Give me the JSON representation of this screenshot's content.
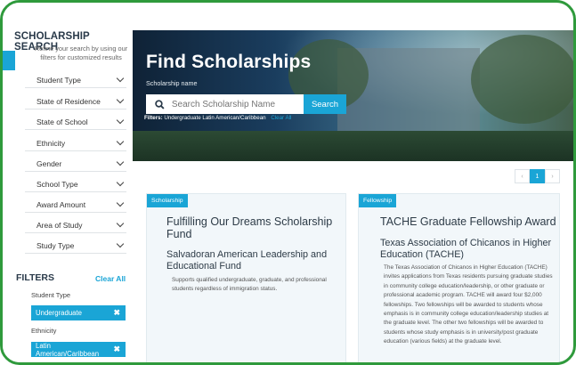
{
  "sidebar": {
    "title": "SCHOLARSHIP SEARCH",
    "subtitle": "Refine your search by using our filters for customized results",
    "selects": [
      {
        "label": "Student Type"
      },
      {
        "label": "State of Residence"
      },
      {
        "label": "State of School"
      },
      {
        "label": "Ethnicity"
      },
      {
        "label": "Gender"
      },
      {
        "label": "School Type"
      },
      {
        "label": "Award Amount"
      },
      {
        "label": "Area of Study"
      },
      {
        "label": "Study Type"
      }
    ],
    "filters_heading": "FILTERS",
    "clear_all": "Clear All",
    "active_groups": [
      {
        "label": "Student Type",
        "chip": "Undergraduate",
        "remove": "✖"
      },
      {
        "label": "Ethnicity",
        "chip": "Latin American/Caribbean",
        "remove": "✖"
      }
    ]
  },
  "hero": {
    "title": "Find Scholarships",
    "subtitle": "Scholarship name",
    "search_placeholder": "Search Scholarship Name",
    "search_button": "Search",
    "filters_label": "Filters:",
    "filters_value": "Undergraduate Latin American/Caribbean",
    "clear_all": "Clear All"
  },
  "pagination": {
    "prev": "‹",
    "current": "1",
    "next": "›"
  },
  "results": [
    {
      "badge": "Scholarship",
      "title": "Fulfilling Our Dreams Scholarship Fund",
      "organization": "Salvadoran American Leadership and Educational Fund",
      "description": "Supports qualified undergraduate, graduate, and professional students regardless of immigration status."
    },
    {
      "badge": "Fellowship",
      "title": "TACHE Graduate Fellowship Award",
      "organization": "Texas Association of Chicanos in Higher Education (TACHE)",
      "description": "The Texas Association of Chicanos in Higher Education (TACHE) invites applications from Texas residents pursuing graduate studies in community college education/leadership, or other graduate or professional academic program. TACHE will award four $2,000 fellowships. Two fellowships will be awarded to students whose emphasis is in community college education/leadership studies at the graduate level. The other two fellowships will be awarded to students whose study emphasis is in university/post graduate education (various fields) at the graduate level."
    }
  ],
  "colors": {
    "accent": "#1aa5d6",
    "frame": "#2f9a3c",
    "heading": "#2a3a4a"
  }
}
